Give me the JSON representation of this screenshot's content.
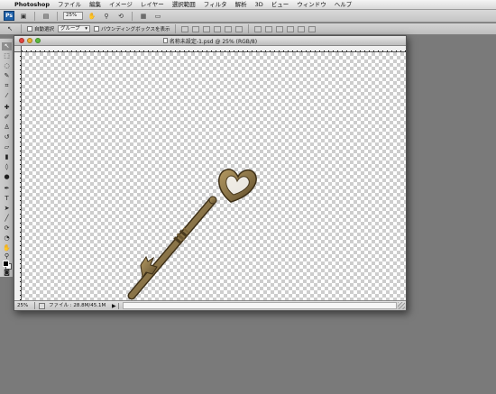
{
  "menubar": {
    "app_name": "Photoshop",
    "items": [
      "ファイル",
      "編集",
      "イメージ",
      "レイヤー",
      "選択範囲",
      "フィルタ",
      "解析",
      "3D",
      "ビュー",
      "ウィンドウ",
      "ヘルプ"
    ]
  },
  "appbar": {
    "logo": "Ps",
    "zoom": "25%"
  },
  "options_bar": {
    "auto_select_label": "自動選択",
    "group_select_value": "グループ",
    "bounding_box_label": "バウンディングボックスを表示"
  },
  "document": {
    "title": "名称未設定-1.psd @ 25% (RGB/8)",
    "status_zoom": "25%",
    "status_info": "ファイル : 28.8M/45.1M"
  },
  "icons": {
    "move_tool": "move-tool-icon",
    "hand": "hand-icon",
    "zoom": "zoom-icon"
  },
  "colors": {
    "key_brass": "#8a7448",
    "key_dark": "#5a4726",
    "canvas_checker": "#cdcdcd"
  }
}
